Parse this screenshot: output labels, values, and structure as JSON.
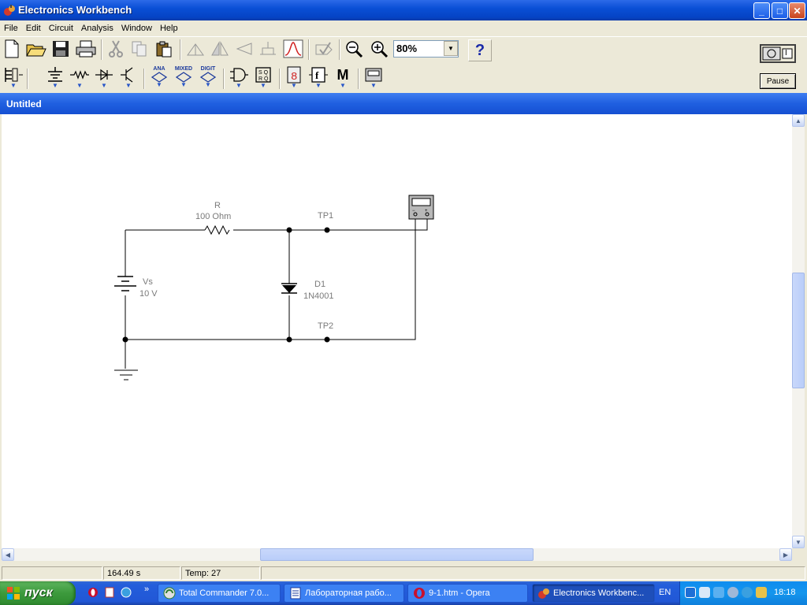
{
  "window": {
    "title": "Electronics Workbench",
    "controls": {
      "minimize": "_",
      "maximize": "□",
      "close": "✕"
    }
  },
  "menu": [
    "File",
    "Edit",
    "Circuit",
    "Analysis",
    "Window",
    "Help"
  ],
  "toolbar": {
    "zoom": "80%",
    "help": "?",
    "part_bins": {
      "analog": "ANA",
      "mixed": "MIXED",
      "digital": "DIGIT",
      "misc": "M"
    },
    "power_label": "I",
    "pause": "Pause"
  },
  "document": {
    "title": "Untitled",
    "circuit": {
      "resistor": {
        "name": "R",
        "value": "100  Ohm"
      },
      "source": {
        "name": "Vs",
        "value": "10 V"
      },
      "diode": {
        "name": "D1",
        "value": "1N4001"
      },
      "test_points": [
        "TP1",
        "TP2"
      ]
    }
  },
  "status": {
    "time": "164.49 s",
    "temp": "Temp:  27"
  },
  "taskbar": {
    "start": "пуск",
    "quick_more": "»",
    "tasks": [
      {
        "label": "Total Commander 7.0...",
        "active": false
      },
      {
        "label": "Лабораторная рабо...",
        "active": false
      },
      {
        "label": "9-1.htm - Opera",
        "active": false
      },
      {
        "label": "Electronics Workbenc...",
        "active": true
      }
    ],
    "lang": "EN",
    "clock": "18:18"
  }
}
